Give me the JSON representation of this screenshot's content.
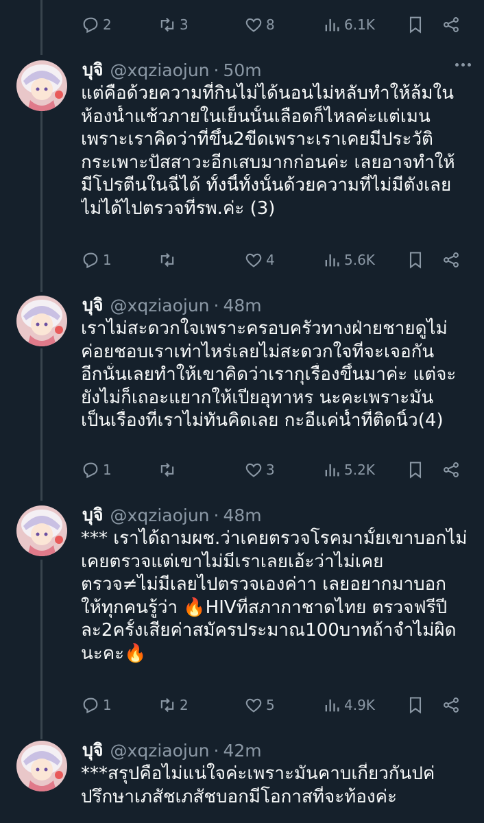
{
  "top_actions": {
    "replies": "2",
    "retweets": "3",
    "likes": "8",
    "views": "6.1K"
  },
  "tweets": [
    {
      "name": "บุจิ",
      "handle": "@xqziaojun",
      "separator": "·",
      "time": "50m",
      "lines": [
        "แต่คือด้วยความที่กินไม่ได้นอนไม่หลับทำให้ล้มใน",
        "ห้องน้ำแช้วภายในเย็นนั้นเลือดก็ไหลค่ะแต่เมน",
        "เพราะเราคิดว่าที่ขึ้น2ขีดเพราะเราเคยมีประวัติ",
        "กระเพาะปัสสาวะอีกเสบมากก่อนค่ะ เลยอาจทำให้",
        "มีโปรตีนในฉี่ได้ ทั้งนี้ทั้งนั้นด้วยความที่ไม่มีตังเลย",
        "ไม่ได้ไปตรวจที่รพ.ค่ะ (3)"
      ],
      "replies": "1",
      "retweets": "",
      "likes": "4",
      "views": "5.6K"
    },
    {
      "name": "บุจิ",
      "handle": "@xqziaojun",
      "separator": "·",
      "time": "48m",
      "lines": [
        "เราไม่สะดวกใจเพราะครอบครัวทางฝ่ายชายดูไม่",
        "ค่อยชอบเราเท่าไหร่เลยไม่สะดวกใจที่จะเจอกัน",
        "อีกนั่นเลยทำให้เขาคิดว่าเรากุเรื่องขึ้นมาค่ะ แต่จะ",
        "ยังไม่ก็เถอะแยากให้เปียอุทาหร นะคะเพราะมัน",
        "เป็นเรื่องที่เราไม่ทันคิดเลย กะอีแค่น้ำที่ติดนิ้ว(4)"
      ],
      "replies": "1",
      "retweets": "",
      "likes": "3",
      "views": "5.2K"
    },
    {
      "name": "บุจิ",
      "handle": "@xqziaojun",
      "separator": "·",
      "time": "48m",
      "lines": [
        "*** เราได้ถามผช.ว่าเคยตรวจโรคมามั้ยเขาบอกไม่",
        "เคยตรวจแต่เขาไม่มีเราเลยเอ้ะว่าไม่เคย",
        "ตรวจ≠ไม่มีเลยไปตรวจเองค่าา เลยอยากมาบอก",
        "ให้ทุกคนรู้ว่า 🔥HIVที่สภากาชาดไทย ตรวจฟรีปี",
        "ละ2ครั้งเสียค่าสมัครประมาณ100บาทถ้าจำไม่ผิด",
        "นะคะ🔥"
      ],
      "replies": "1",
      "retweets": "2",
      "likes": "5",
      "views": "4.9K"
    },
    {
      "name": "บุจิ",
      "handle": "@xqziaojun",
      "separator": "·",
      "time": "42m",
      "lines": [
        "***สรุปคือไม่แน่ใจค่ะเพราะมันคาบเกี่ยวกันปค่",
        "ปรึกษาเภสัชเภสัชบอกมีโอกาสที่จะท้องค่ะ"
      ]
    }
  ],
  "colors": {
    "background": "#15202b",
    "text": "#f7f9f9",
    "muted": "#8b98a5",
    "line": "#38444d"
  },
  "icons": [
    "reply-icon",
    "retweet-icon",
    "like-icon",
    "views-icon",
    "bookmark-icon",
    "share-icon",
    "more-icon"
  ]
}
